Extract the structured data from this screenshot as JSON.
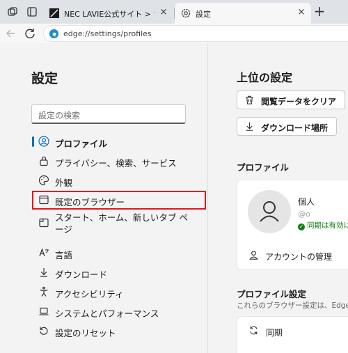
{
  "tabstrip": {
    "tab1": {
      "title": "NEC LAVIE公式サイト > サービス＆サ",
      "close": "×"
    },
    "tab2": {
      "title": "設定",
      "close": "×"
    },
    "new_tab": "+"
  },
  "toolbar": {
    "url": "edge://settings/profiles"
  },
  "sidebar": {
    "title": "設定",
    "search_placeholder": "設定の検索",
    "items": [
      {
        "label": "プロファイル",
        "icon": "profile-icon"
      },
      {
        "label": "プライバシー、検索、サービス",
        "icon": "lock-icon"
      },
      {
        "label": "外観",
        "icon": "palette-icon"
      },
      {
        "label": "既定のブラウザー",
        "icon": "browser-icon"
      },
      {
        "label": "スタート、ホーム、新しいタブ ページ",
        "icon": "start-page-icon"
      },
      {
        "label": "言語",
        "icon": "language-icon"
      },
      {
        "label": "ダウンロード",
        "icon": "download-icon"
      },
      {
        "label": "アクセシビリティ",
        "icon": "accessibility-icon"
      },
      {
        "label": "システムとパフォーマンス",
        "icon": "laptop-icon"
      },
      {
        "label": "設定のリセット",
        "icon": "reset-icon"
      }
    ]
  },
  "main": {
    "title": "上位の設定",
    "clear_data_label": "閲覧データをクリア",
    "downloads_label": "ダウンロード場所",
    "profiles_section": "プロファイル",
    "profile_name": "個人",
    "profile_email": "@o",
    "sync_status": "同期は有効に",
    "manage_account": "アカウントの管理",
    "profile_settings_section": "プロファイル設定",
    "profile_settings_desc": "これらのブラウザー設定は、Edge",
    "sync_label": "同期"
  },
  "colors": {
    "accent": "#0f6cbd",
    "highlight_border": "#e8141a",
    "sync_green": "#107c10"
  }
}
